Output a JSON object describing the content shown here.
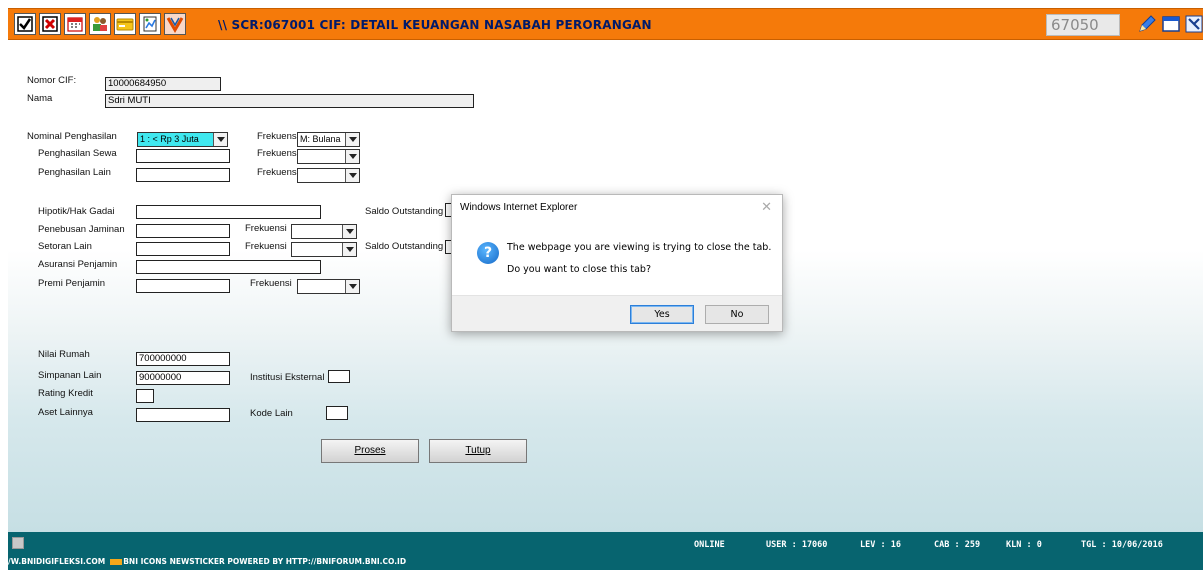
{
  "toolbar": {
    "title": "\\\\ SCR:067001 CIF: DETAIL KEUANGAN NASABAH PERORANGAN",
    "code": "67050"
  },
  "form": {
    "nomor_cif": {
      "label": "Nomor CIF:",
      "value": "10000684950"
    },
    "nama": {
      "label": "Nama",
      "value": "Sdri MUTI"
    },
    "nominal_penghasilan": {
      "label": "Nominal Penghasilan",
      "value": "1 : < Rp 3 Juta"
    },
    "penghasilan_sewa": {
      "label": "Penghasilan Sewa",
      "value": ""
    },
    "penghasilan_lain": {
      "label": "Penghasilan Lain",
      "value": ""
    },
    "frekuensi_label": "Frekuensi",
    "frekuensi_1": "M: Bulana",
    "frekuensi_2": "",
    "frekuensi_3": "",
    "hipotik": {
      "label": "Hipotik/Hak Gadai",
      "value": ""
    },
    "saldo_outstanding_label": "Saldo Outstanding",
    "penebusan_jaminan": {
      "label": "Penebusan Jaminan",
      "value": ""
    },
    "setoran_lain": {
      "label": "Setoran Lain",
      "value": ""
    },
    "asuransi_penjamin": {
      "label": "Asuransi Penjamin",
      "value": ""
    },
    "premi_penjamin": {
      "label": "Premi Penjamin",
      "value": ""
    },
    "frekuensi_4": "",
    "frekuensi_5": "",
    "frekuensi_6": "",
    "nilai_rumah": {
      "label": "Nilai Rumah",
      "value": "700000000"
    },
    "simpanan_lain": {
      "label": "Simpanan Lain",
      "value": "90000000"
    },
    "institusi_eksternal": {
      "label": "Institusi Eksternal",
      "value": ""
    },
    "rating_kredit": {
      "label": "Rating Kredit",
      "value": ""
    },
    "aset_lainnya": {
      "label": "Aset Lainnya",
      "value": ""
    },
    "kode_lain": {
      "label": "Kode Lain",
      "value": ""
    }
  },
  "buttons": {
    "proses": "Proses",
    "tutup": "Tutup"
  },
  "dialog": {
    "title": "Windows Internet Explorer",
    "message1": "The webpage you are viewing is trying to close the tab.",
    "message2": "Do you want to close this tab?",
    "yes": "Yes",
    "no": "No"
  },
  "status": {
    "online": "ONLINE",
    "user": "USER : 17060",
    "lev": "LEV : 16",
    "cab": "CAB : 259",
    "kln": "KLN : 0",
    "tgl": "TGL : 10/06/2016",
    "ticker_left": "/W.BNIDIGIFLEKSI.COM",
    "ticker_right": "BNI ICONS NEWSTICKER POWERED BY HTTP://BNIFORUM.BNI.CO.ID"
  },
  "colors": {
    "topbar": "#f57a0a",
    "statusbar": "#07646f",
    "highlight": "#3fe8ef"
  }
}
